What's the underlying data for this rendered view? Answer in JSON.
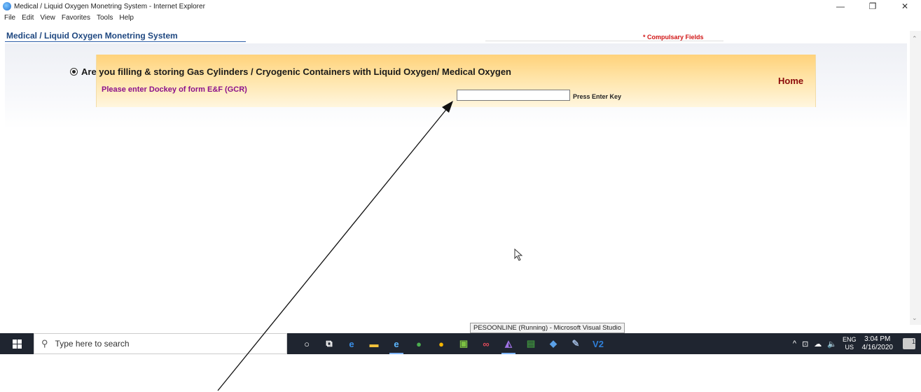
{
  "window": {
    "title": "Medical / Liquid Oxygen Monetring System - Internet Explorer",
    "controls": {
      "minimize": "—",
      "restore": "❐",
      "close": "✕"
    }
  },
  "menu": [
    "File",
    "Edit",
    "View",
    "Favorites",
    "Tools",
    "Help"
  ],
  "page": {
    "app_title": "Medical / Liquid Oxygen Monetring System",
    "compulsory_note": "* Compulsary Fields",
    "question": "Are you filling & storing Gas Cylinders / Cryogenic Containers with Liquid Oxygen/ Medical Oxygen",
    "question_selected": true,
    "home_link": "Home",
    "dockey_label": "Please enter Dockey of form E&F (GCR)",
    "dockey_value": "",
    "enter_hint": "Press Enter Key"
  },
  "tooltip": "PESOONLINE (Running) - Microsoft Visual Studio",
  "taskbar": {
    "search_placeholder": "Type here to search",
    "apps": [
      {
        "name": "cortana-icon",
        "glyph": "○",
        "color": "#ffffff"
      },
      {
        "name": "task-view-icon",
        "glyph": "⧉",
        "color": "#ffffff"
      },
      {
        "name": "edge-icon",
        "glyph": "e",
        "color": "#3a8ee6"
      },
      {
        "name": "file-explorer-icon",
        "glyph": "▬",
        "color": "#f2c23c"
      },
      {
        "name": "internet-explorer-icon",
        "glyph": "e",
        "color": "#5cb7ff",
        "active": true
      },
      {
        "name": "app-green-icon",
        "glyph": "●",
        "color": "#4caf50"
      },
      {
        "name": "chrome-icon",
        "glyph": "●",
        "color": "#f4b400"
      },
      {
        "name": "app-tools-icon",
        "glyph": "▣",
        "color": "#7cc242"
      },
      {
        "name": "app-infinity-icon",
        "glyph": "∞",
        "color": "#e04a5a"
      },
      {
        "name": "visual-studio-icon",
        "glyph": "◭",
        "color": "#a072e6",
        "active": true
      },
      {
        "name": "app-chart-icon",
        "glyph": "▤",
        "color": "#3d8b3d"
      },
      {
        "name": "app-blue-icon",
        "glyph": "◆",
        "color": "#5aa0e6"
      },
      {
        "name": "app-wrench-icon",
        "glyph": "✎",
        "color": "#9ab3d6"
      },
      {
        "name": "app-v2-icon",
        "glyph": "V2",
        "color": "#2f7fd8"
      }
    ],
    "tray_symbols": [
      "^",
      "⊡",
      "☁",
      "🔈"
    ],
    "lang_top": "ENG",
    "lang_bottom": "US",
    "time": "3:04 PM",
    "date": "4/16/2020",
    "notification_count": "1"
  }
}
